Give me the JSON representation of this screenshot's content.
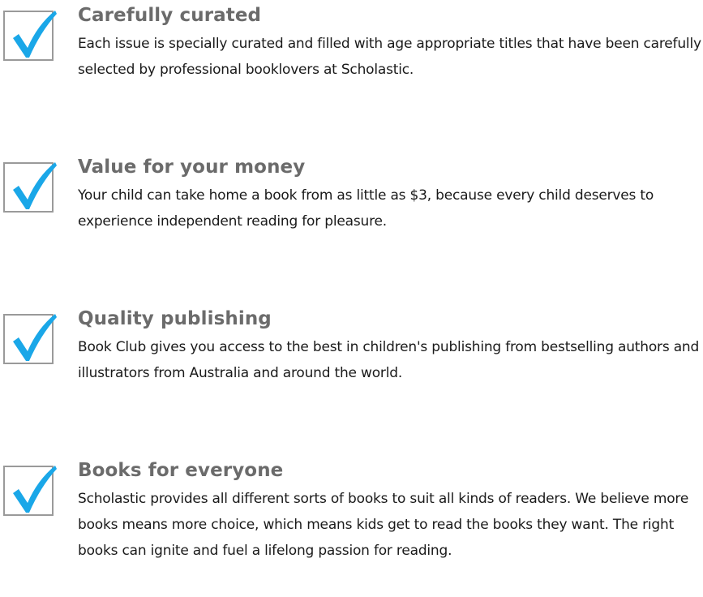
{
  "accent_color": "#1aa7e8",
  "features": [
    {
      "icon": "checkmark-checkbox-icon",
      "title": "Carefully curated",
      "description": "Each issue is specially curated and filled with age appropriate titles that have been carefully selected by professional booklovers at Scholastic."
    },
    {
      "icon": "checkmark-checkbox-icon",
      "title": "Value for your money",
      "description": "Your child can take home a book from as little as $3, because every child deserves to experience independent reading for pleasure."
    },
    {
      "icon": "checkmark-checkbox-icon",
      "title": "Quality publishing",
      "description": "Book Club gives you access to the best in children's publishing from bestselling authors and illustrators from Australia and around the world."
    },
    {
      "icon": "checkmark-checkbox-icon",
      "title": "Books for everyone",
      "description": "Scholastic provides all different sorts of books to suit all kinds of readers. We believe more books means more choice, which means kids get to read the books they want. The right books can ignite and fuel a lifelong passion for reading."
    }
  ]
}
